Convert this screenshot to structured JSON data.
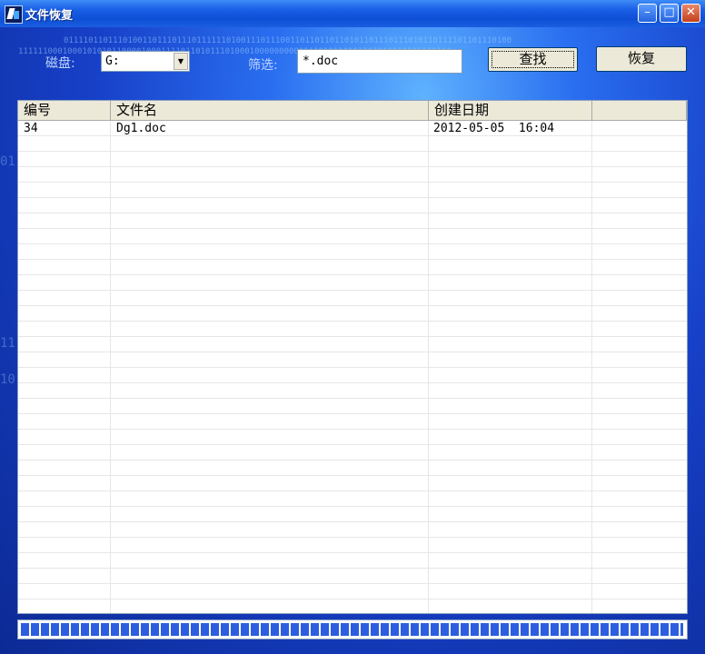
{
  "window": {
    "title": "文件恢复",
    "controls": {
      "minimize": "–",
      "maximize": "□",
      "close": "✕"
    }
  },
  "toolbar": {
    "disk_label": "磁盘:",
    "disk_value": "G:",
    "filter_label": "筛选:",
    "filter_value": "*.doc",
    "search_label": "查找",
    "recover_label": "恢复"
  },
  "table": {
    "columns": [
      "编号",
      "文件名",
      "创建日期"
    ],
    "rows": [
      {
        "id": "34",
        "name": "Dg1.doc",
        "date": "2012-05-05  16:04"
      }
    ]
  },
  "progress": {
    "value_percent": 100
  },
  "colors": {
    "title_bar": "#1a5fe6",
    "progress_fill": "#2d5ee0",
    "background": "#1740c8"
  }
}
